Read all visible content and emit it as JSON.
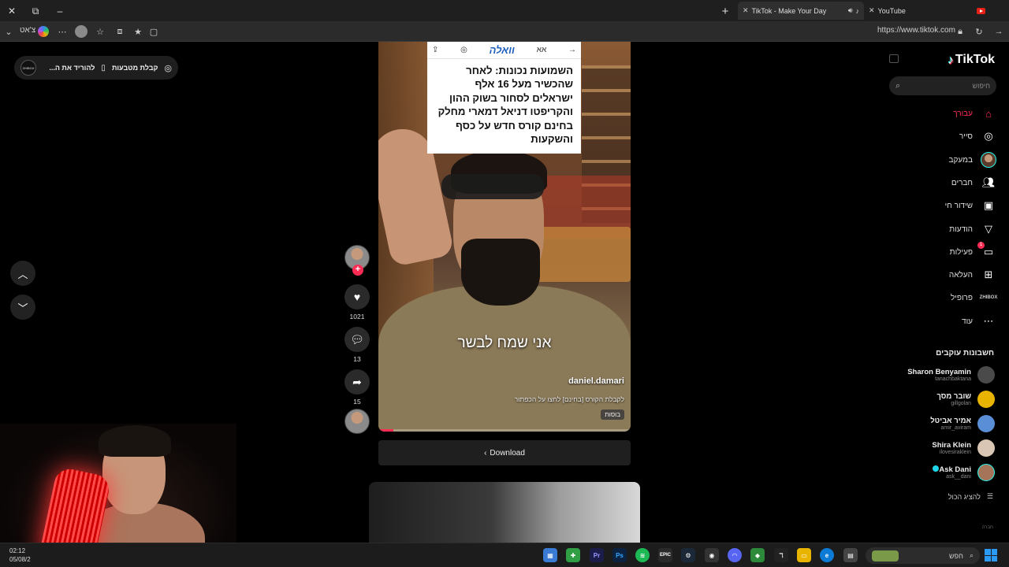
{
  "browser": {
    "tabs": [
      {
        "title": "TikTok - Make Your Day",
        "active": true
      },
      {
        "title": "YouTube",
        "active": false
      }
    ],
    "profile_label": "צ'אט",
    "url": "https://www.tiktok.com"
  },
  "overlay": {
    "get_coins": "קבלת מטבעות",
    "download_app": "להוריד את ה...",
    "zc_badge": "ZHIBOX"
  },
  "video": {
    "article_headline": "השמועות נכונות: לאחר שהכשיר מעל 16 אלף ישראלים לסחור בשוק ההון והקריפטו דניאל דמארי מחלק בחינם קורס חדש על כסף והשקעות",
    "article_source": "וואלה",
    "article_font_toggle": "אא",
    "subtitle": "אני שמח לבשר",
    "author": "daniel.damari",
    "description": "לקבלת הקורס [בחינם] לחצו על הכפתור",
    "more_tag": "בוסות",
    "progress": 0.06
  },
  "actions": {
    "likes": "1021",
    "comments": "13",
    "shares": "15"
  },
  "download_label": "Download",
  "sidebar": {
    "logo_text": "TikTok",
    "search_placeholder": "חיפוש",
    "menu": [
      {
        "label": "עבורך",
        "icon": "home-icon",
        "active": true
      },
      {
        "label": "סייר",
        "icon": "compass-icon",
        "active": false
      },
      {
        "label": "במעקב",
        "icon": "following-avatar-icon",
        "active": false
      },
      {
        "label": "חברים",
        "icon": "friends-icon",
        "active": false
      },
      {
        "label": "שידור חי",
        "icon": "live-icon",
        "active": false
      },
      {
        "label": "הודעות",
        "icon": "messages-icon",
        "active": false
      },
      {
        "label": "פעילות",
        "icon": "activity-icon",
        "active": false,
        "badge": "1"
      },
      {
        "label": "העלאה",
        "icon": "upload-icon",
        "active": false
      },
      {
        "label": "פרופיל",
        "icon": "profile-icon",
        "active": false
      },
      {
        "label": "עוד",
        "icon": "more-icon",
        "active": false
      }
    ],
    "following_title": "חשבונות עוקבים",
    "following": [
      {
        "name": "Sharon Benyamin",
        "handle": "tanachbaktana",
        "color": "#4a4a4a"
      },
      {
        "name": "שובר מסך",
        "handle": "gillgolan",
        "color": "#e8b400"
      },
      {
        "name": "אמיר אביטל",
        "handle": "amir_aviram",
        "color": "#5a8fd8"
      },
      {
        "name": "Shira Klein",
        "handle": "ilovesiraklein",
        "color": "#d9c6b4"
      },
      {
        "name": "Ask Dani",
        "handle": "ask__dani",
        "color": "#a67458",
        "verified": true
      }
    ],
    "show_all": "להציג הכול",
    "footer": "חברה"
  },
  "taskbar": {
    "time": "02:12",
    "date": "05/08/2",
    "search_label": "חפש"
  }
}
